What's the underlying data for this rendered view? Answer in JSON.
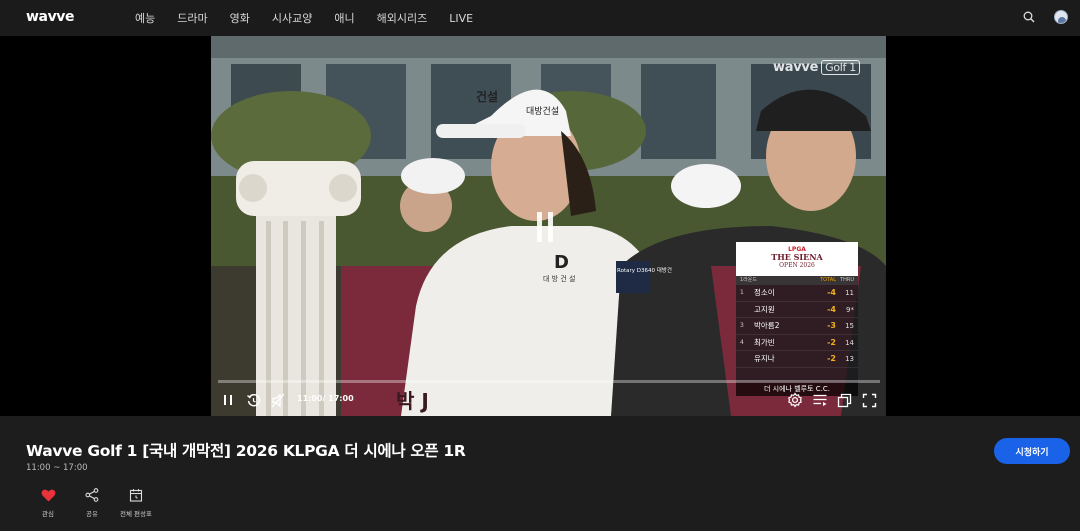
{
  "brand": {
    "logo_text": "wavve"
  },
  "nav": {
    "items": [
      {
        "label": "예능"
      },
      {
        "label": "드라마"
      },
      {
        "label": "영화"
      },
      {
        "label": "시사교양"
      },
      {
        "label": "애니"
      },
      {
        "label": "해외시리즈"
      },
      {
        "label": "LIVE"
      }
    ],
    "search_icon": "search-icon",
    "profile_icon": "avatar"
  },
  "player": {
    "watermark": "wavve",
    "watermark_channel": "Golf 1",
    "state": "playing",
    "time_display": "11:00/ 17:00",
    "progress": 0.0,
    "leaderboard": {
      "brand": "LPGA",
      "event_title": "THE SIENA",
      "event_sub": "OPEN 2026",
      "col_round": "1라운드",
      "col_total": "TOTAL",
      "col_thru": "THRU",
      "rows": [
        {
          "rank": "1",
          "name": "정소이",
          "score": "-4",
          "thru": "11"
        },
        {
          "rank": "",
          "name": "고지원",
          "score": "-4",
          "thru": "9*"
        },
        {
          "rank": "3",
          "name": "박아름2",
          "score": "-3",
          "thru": "15"
        },
        {
          "rank": "4",
          "name": "최가빈",
          "score": "-2",
          "thru": "14"
        },
        {
          "rank": "",
          "name": "유지나",
          "score": "-2",
          "thru": "13"
        }
      ],
      "venue": "더 시에나 벨루토 C.C."
    },
    "scene_text": {
      "cap_left": "건설",
      "cap_sponsor": "대방건설",
      "shirt_logo": "D",
      "shirt_text": "대 방 건 설",
      "sleeve_patch": "Rotary D3640 대방건",
      "vest_text": "박 J"
    }
  },
  "program": {
    "title": "Wavve Golf 1 [국내 개막전] 2026 KLPGA 더 시에나 오픈 1R",
    "time_range": "11:00 ~ 17:00",
    "watch_button": "시청하기",
    "actions": [
      {
        "label": "관심",
        "icon": "heart-icon"
      },
      {
        "label": "공유",
        "icon": "share-icon"
      },
      {
        "label": "전체 편성표",
        "icon": "schedule-icon"
      }
    ]
  },
  "colors": {
    "accent": "#1a63e8",
    "heart": "#e8323c",
    "score": "#f2b01e"
  }
}
